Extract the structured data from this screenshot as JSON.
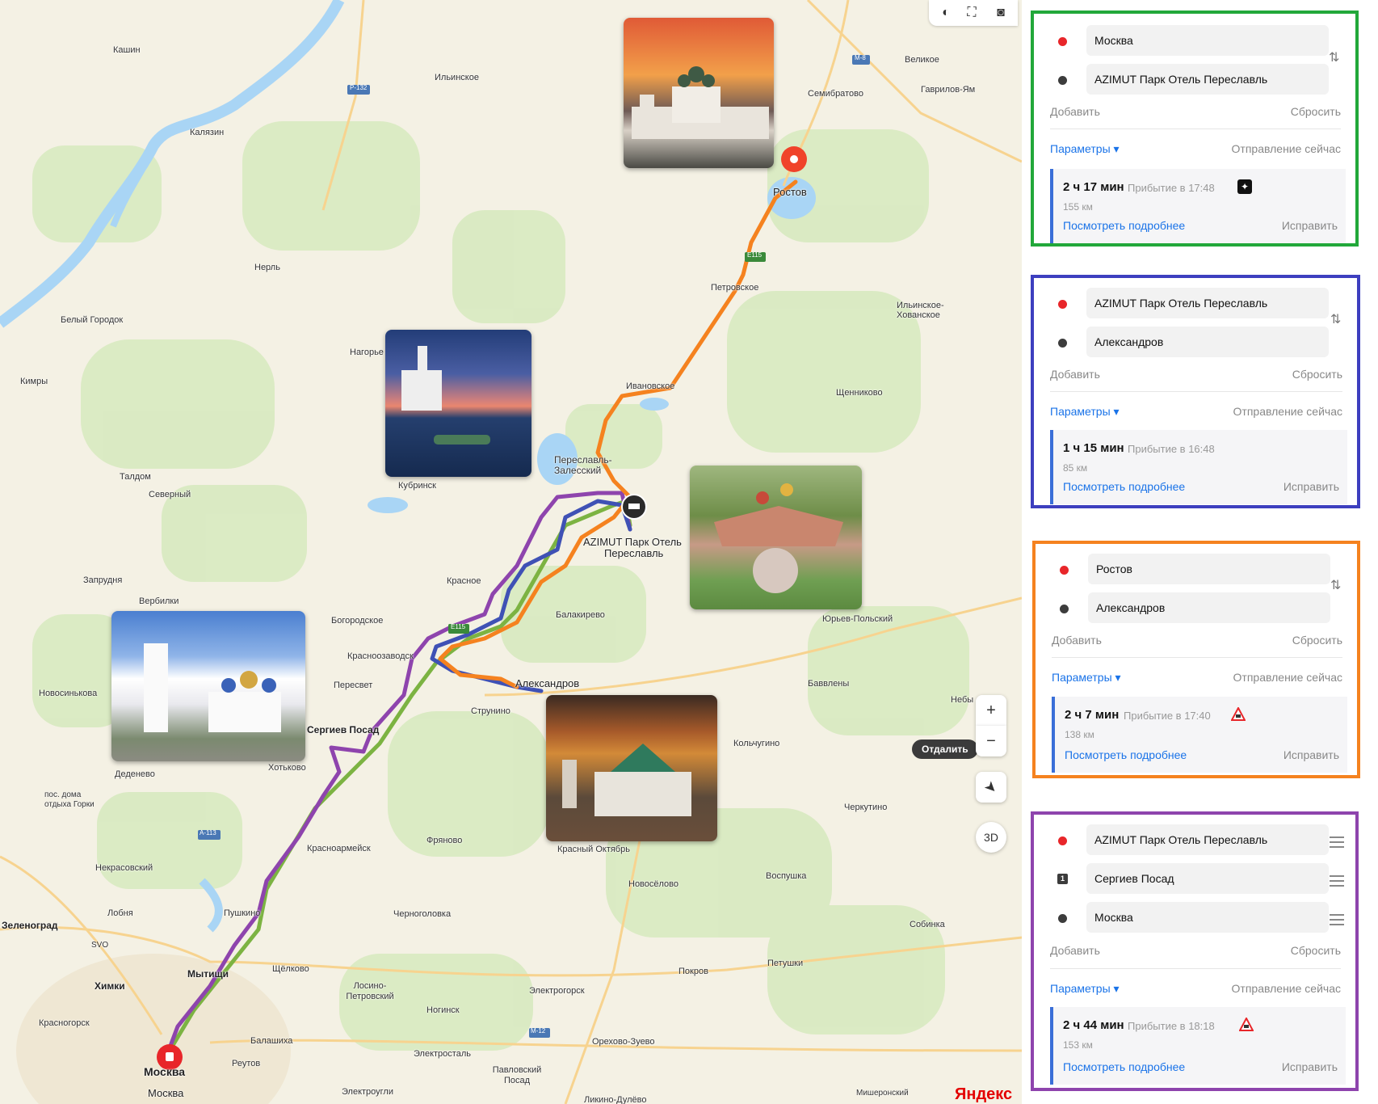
{
  "map": {
    "brand": "Яндекс",
    "distance_button": "Отдалить",
    "btn_3d": "3D",
    "zoom_in": "+",
    "zoom_out": "−",
    "route_labels": [
      {
        "text": "Ростов"
      },
      {
        "text": "AZIMUT Парк Отель"
      },
      {
        "text": "Переславль"
      },
      {
        "text": "Александров"
      },
      {
        "text": "Москва"
      }
    ],
    "place_labels": [
      "Кашин",
      "Калязин",
      "Ильинское",
      "Семибратово",
      "Великое",
      "Гаврилов-Ям",
      "Нерль",
      "Белый Городок",
      "Кимры",
      "Петровское",
      "Ильинское-Хованское",
      "Нагорье",
      "Ивановское",
      "Щенниково",
      "Переславль-Залесский",
      "Кубринск",
      "Талдом",
      "Северный",
      "Запрудня",
      "Вербилки",
      "Красное",
      "Балакирево",
      "Юрьев-Польский",
      "Богородское",
      "Красноозаводск",
      "Пересвет",
      "Струнино",
      "Баввлены",
      "Новосинькова",
      "Сергиев Посад",
      "Хотьково",
      "Деденево",
      "пос. дома отдыха Горки",
      "Кольчугино",
      "Небы",
      "Красноармейск",
      "Фряново",
      "Черкутино",
      "Некрасовский",
      "Красный Октябрь",
      "Новосёлово",
      "Воспушка",
      "Зеленоград",
      "Лобня",
      "Пушкино",
      "Черноголовка",
      "Собинка",
      "SVO",
      "Химки",
      "Мытищи",
      "Щёлково",
      "Лосино-Петровский",
      "Покров",
      "Петушки",
      "Электрогорск",
      "Красногорск",
      "Ногинск",
      "Балашиха",
      "Реутов",
      "Электросталь",
      "Орехово-Зуево",
      "Павловский Посад",
      "Электроугли",
      "Ликино-Дулёво",
      "Мишеронский",
      "Москва"
    ],
    "road_badges": [
      "P-132",
      "M-8",
      "E115",
      "E115",
      "A-113",
      "M-12"
    ],
    "photo_icons": [
      "rostov-kremlin-photo",
      "pereslavl-church-photo",
      "azimut-hotel-photo",
      "sergiev-posad-photo",
      "alexandrov-kremlin-photo"
    ],
    "colors": {
      "green": "#7cb342",
      "blue": "#3f51b5",
      "orange": "#f5821f",
      "purple": "#8e44ad",
      "water": "#a9d5f5"
    }
  },
  "panels": [
    {
      "border": "#22a83a",
      "from": "Москва",
      "to": "AZIMUT Парк Отель Переславль",
      "add": "Добавить",
      "reset": "Сбросить",
      "params": "Параметры ▾",
      "departure": "Отправление сейчас",
      "time": "2 ч 17 мин",
      "arrival": "Прибытие в 17:48",
      "distance": "155 км",
      "details": "Посмотреть подробнее",
      "fix": "Исправить",
      "icon": "traffic-light-icon"
    },
    {
      "border": "#3d3fbf",
      "from": "AZIMUT Парк Отель Переславль",
      "to": "Александров",
      "add": "Добавить",
      "reset": "Сбросить",
      "params": "Параметры ▾",
      "departure": "Отправление сейчас",
      "time": "1 ч 15 мин",
      "arrival": "Прибытие в 16:48",
      "distance": "85 км",
      "details": "Посмотреть подробнее",
      "fix": "Исправить"
    },
    {
      "border": "#f5821f",
      "from": "Ростов",
      "to": "Александров",
      "add": "Добавить",
      "reset": "Сбросить",
      "params": "Параметры ▾",
      "departure": "Отправление сейчас",
      "time": "2 ч 7 мин",
      "arrival": "Прибытие в 17:40",
      "distance": "138 км",
      "details": "Посмотреть подробнее",
      "fix": "Исправить",
      "icon": "road-works-icon"
    },
    {
      "border": "#8e44ad",
      "from": "AZIMUT Парк Отель Переславль",
      "via_num": "1",
      "via": "Сергиев Посад",
      "to": "Москва",
      "add": "Добавить",
      "reset": "Сбросить",
      "params": "Параметры ▾",
      "departure": "Отправление сейчас",
      "time": "2 ч 44 мин",
      "arrival": "Прибытие в 18:18",
      "distance": "153 км",
      "details": "Посмотреть подробнее",
      "fix": "Исправить",
      "icon": "road-works-icon"
    }
  ]
}
